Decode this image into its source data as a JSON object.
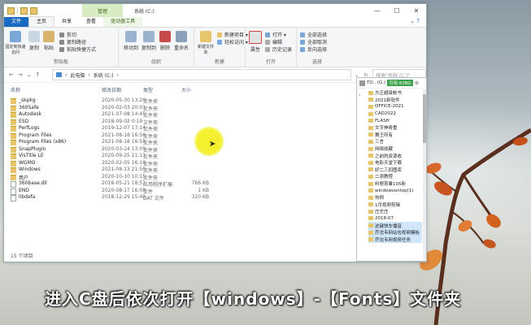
{
  "window": {
    "title": "系统 (C:)",
    "manage_tab": "管理",
    "tabs": [
      "文件",
      "主页",
      "共享",
      "查看",
      "驱动器工具"
    ],
    "controls": {
      "minimize": "—",
      "maximize": "☐",
      "close": "✕"
    }
  },
  "ribbon": {
    "clipboard": {
      "label": "剪贴板",
      "pin": "固定到快速访问",
      "copy": "复制",
      "paste": "粘贴",
      "cut": "剪切",
      "copy_path": "复制路径",
      "paste_shortcut": "粘贴快捷方式"
    },
    "organize": {
      "label": "组织",
      "move_to": "移动到",
      "copy_to": "复制到",
      "delete": "删除",
      "rename": "重命名"
    },
    "new": {
      "label": "新建",
      "new_folder": "新建文件夹",
      "new_item": "新建项目 ▾",
      "easy_access": "轻松访问 ▾"
    },
    "open": {
      "label": "打开",
      "properties": "属性",
      "open": "打开 ▾",
      "edit": "编辑",
      "history": "历史记录"
    },
    "select": {
      "label": "选择",
      "select_all": "全部选择",
      "select_none": "全部取消",
      "invert": "反向选择"
    }
  },
  "address": {
    "path": [
      "此电脑",
      "系统 (C:)"
    ],
    "search_placeholder": "搜索\"系统 (C:)\"",
    "nav": {
      "back": "←",
      "forward": "→",
      "up": "↑",
      "recent": "⌄"
    },
    "dropdown": "⌄",
    "refresh": "↻"
  },
  "columns": {
    "name": "名称",
    "date": "修改日期",
    "type": "类型",
    "size": "大小"
  },
  "files": [
    {
      "name": "_skpkg",
      "date": "2020-05-30 13:20",
      "type": "文件夹",
      "size": "",
      "kind": "folder"
    },
    {
      "name": "360Safe",
      "date": "2020-02-03 20:01",
      "type": "文件夹",
      "size": "",
      "kind": "folder"
    },
    {
      "name": "Autodesk",
      "date": "2021-07-08 14:45",
      "type": "文件夹",
      "size": "",
      "kind": "folder"
    },
    {
      "name": "ESD",
      "date": "2018-09-02 0:19",
      "type": "文件夹",
      "size": "",
      "kind": "folder"
    },
    {
      "name": "PerfLogs",
      "date": "2019-12-07 17:14",
      "type": "文件夹",
      "size": "",
      "kind": "folder"
    },
    {
      "name": "Program Files",
      "date": "2021-08-18 16:56",
      "type": "文件夹",
      "size": "",
      "kind": "folder"
    },
    {
      "name": "Program Files (x86)",
      "date": "2021-08-18 16:58",
      "type": "文件夹",
      "size": "",
      "kind": "folder"
    },
    {
      "name": "SnapPlugin",
      "date": "2020-03-24 13:05",
      "type": "文件夹",
      "size": "",
      "kind": "folder"
    },
    {
      "name": "VisTitle LE",
      "date": "2020-09-25 21:11",
      "type": "文件夹",
      "size": "",
      "kind": "folder"
    },
    {
      "name": "WGMO",
      "date": "2020-02-05 16:18",
      "type": "文件夹",
      "size": "",
      "kind": "folder"
    },
    {
      "name": "Windows",
      "date": "2021-08-13 21:50",
      "type": "文件夹",
      "size": "",
      "kind": "folder"
    },
    {
      "name": "用户",
      "date": "2020-10-10 10:15",
      "type": "文件夹",
      "size": "",
      "kind": "folder"
    },
    {
      "name": "360base.dll",
      "date": "2018-05-21 18:51",
      "type": "应用程序扩展",
      "size": "766 KB",
      "kind": "file"
    },
    {
      "name": "END",
      "date": "2020-08-17 16:08",
      "type": "文件",
      "size": "1 KB",
      "kind": "file"
    },
    {
      "name": "libdefa",
      "date": "2018-12-29 15:40",
      "type": "DAT 文件",
      "size": "320 KB",
      "kind": "file"
    }
  ],
  "status": {
    "count": "15 个项目"
  },
  "panel": {
    "title": "TO...(G:)",
    "badge": "可用 62BG",
    "items": [
      "方正超级帐书",
      "2021新软件",
      "OFFICE-2021",
      "CAD2022",
      "FLASH",
      "文字神奇重",
      "舞王所有",
      "三言",
      "网络收藏",
      "之前的资源收",
      "电影天堂下载",
      "好二三四图库",
      "二测教程",
      "料想育暑105新",
      "windowsontop(1)",
      "热例",
      "1月视频剪辑",
      "庄庄庄",
      "2018-07",
      "这键快车播音",
      "芥沈韦网站包视频模板",
      "芥沈韦网视频任务"
    ]
  },
  "subtitle": "进入C盘后依次打开【windows】-【Fonts】文件夹"
}
